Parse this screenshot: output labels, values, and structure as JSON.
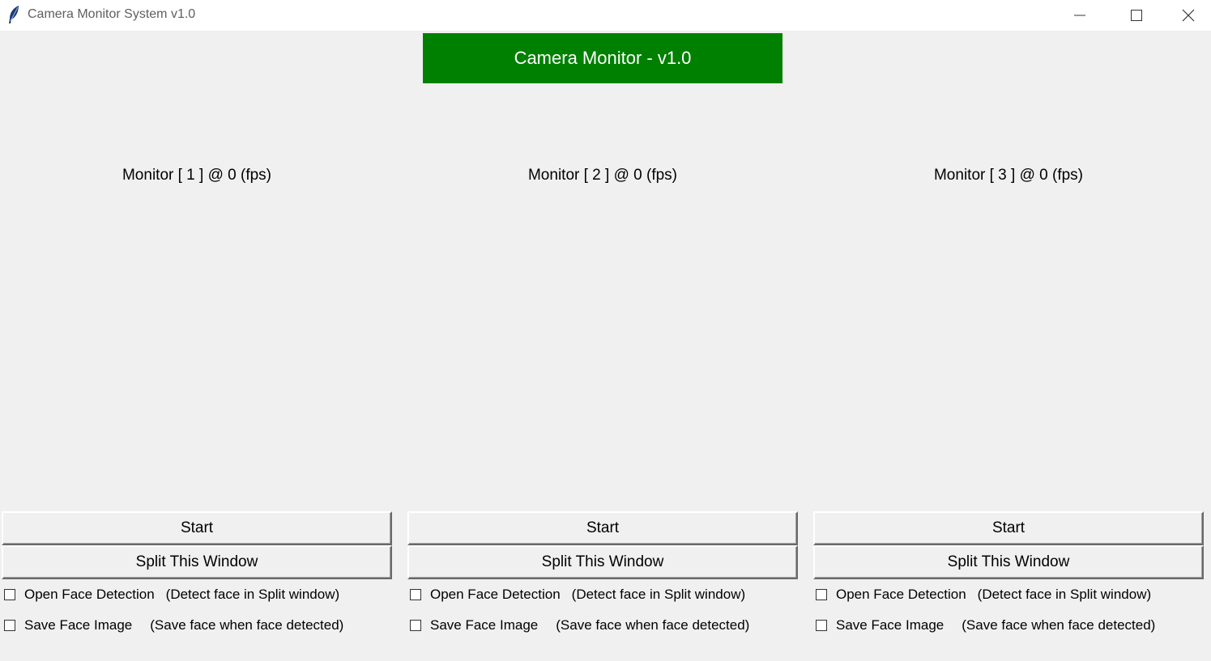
{
  "window": {
    "title": "Camera Monitor System v1.0",
    "icon": "feather-icon"
  },
  "banner": {
    "title": "Camera Monitor - v1.0",
    "color": "#008000"
  },
  "monitors": [
    {
      "label": "Monitor [ 1 ] @  0 (fps)",
      "start_label": "Start",
      "split_label": "Split This Window",
      "face_detection_label": "Open Face Detection",
      "face_detection_note": "(Detect face in Split window)",
      "face_detection_checked": false,
      "save_face_label": "Save Face Image",
      "save_face_note": "(Save face when face detected)",
      "save_face_checked": false
    },
    {
      "label": "Monitor [ 2 ] @  0 (fps)",
      "start_label": "Start",
      "split_label": "Split This Window",
      "face_detection_label": "Open Face Detection",
      "face_detection_note": "(Detect face in Split window)",
      "face_detection_checked": false,
      "save_face_label": "Save Face Image",
      "save_face_note": "(Save face when face detected)",
      "save_face_checked": false
    },
    {
      "label": "Monitor [ 3 ] @  0 (fps)",
      "start_label": "Start",
      "split_label": "Split This Window",
      "face_detection_label": "Open Face Detection",
      "face_detection_note": "(Detect face in Split window)",
      "face_detection_checked": false,
      "save_face_label": "Save Face Image",
      "save_face_note": "(Save face when face detected)",
      "save_face_checked": false
    }
  ]
}
